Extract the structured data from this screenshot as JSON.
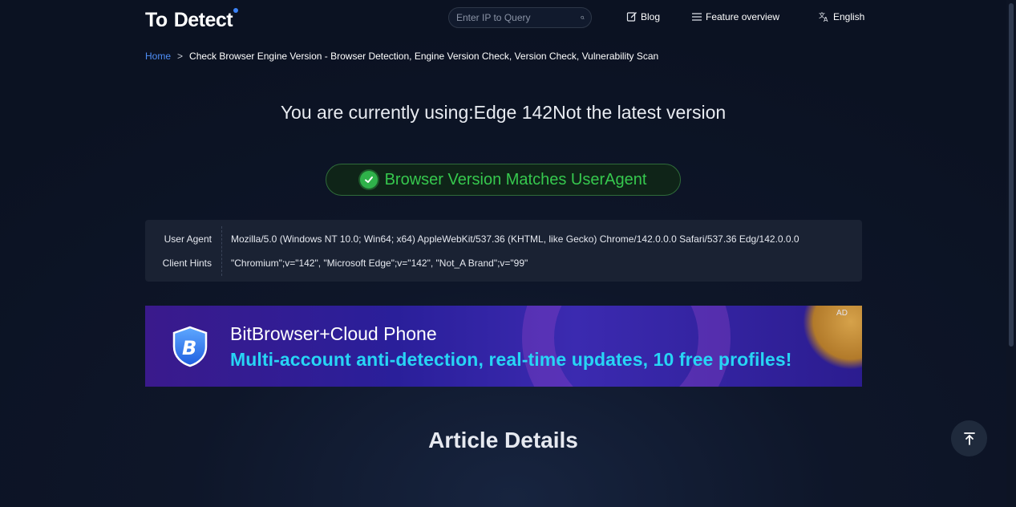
{
  "header": {
    "logo": {
      "part1": "To",
      "part2": "Detect"
    },
    "search": {
      "placeholder": "Enter IP to Query",
      "icon": "search-icon"
    },
    "nav": {
      "blog": "Blog",
      "feature_overview": "Feature overview",
      "language": "English"
    }
  },
  "breadcrumb": {
    "home": "Home",
    "separator": ">",
    "current": "Check Browser Engine Version - Browser Detection, Engine Version Check, Version Check, Vulnerability Scan"
  },
  "headline": "You are currently using:Edge 142Not the latest version",
  "status_badge": {
    "text": "Browser Version Matches UserAgent",
    "color": "#36c84e"
  },
  "ua_info": {
    "user_agent_label": "User Agent",
    "user_agent_value": "Mozilla/5.0 (Windows NT 10.0; Win64; x64) AppleWebKit/537.36 (KHTML, like Gecko) Chrome/142.0.0.0 Safari/537.36 Edg/142.0.0.0",
    "client_hints_label": "Client Hints",
    "client_hints_value": "\"Chromium\";v=\"142\", \"Microsoft Edge\";v=\"142\", \"Not_A Brand\";v=\"99\""
  },
  "ad": {
    "tag": "AD",
    "title": "BitBrowser+Cloud Phone",
    "subtitle": "Multi-account anti-detection, real-time updates, 10 free profiles!"
  },
  "article_title": "Article Details",
  "colors": {
    "accent": "#4f8ef7",
    "background": "#0b1222",
    "success": "#2fb24a"
  }
}
